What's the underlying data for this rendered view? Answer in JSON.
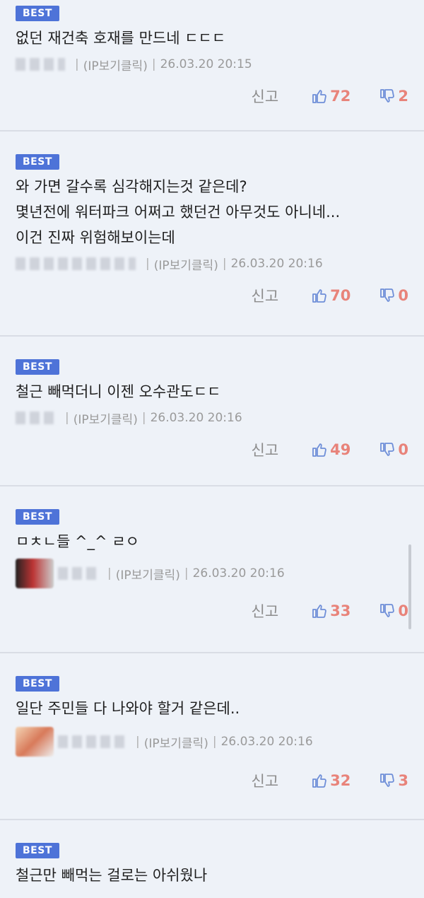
{
  "labels": {
    "best": "BEST",
    "report": "신고",
    "ip": "(IP보기클릭)"
  },
  "colors": {
    "best_badge": "#4e73d8",
    "vote_count": "#e8837a",
    "icon": "#6f8fd8",
    "background": "#eef2f8"
  },
  "comments": [
    {
      "text": "없던 재건축 호재를 만드네 ㄷㄷㄷ",
      "date": "26.03.20 20:15",
      "up": "72",
      "down": "2"
    },
    {
      "text": "와 가면 갈수록 심각해지는것 같은데?\n몇년전에 워터파크 어쩌고 했던건 아무것도 아니네...\n이건 진짜 위험해보이는데",
      "date": "26.03.20 20:16",
      "up": "70",
      "down": "0"
    },
    {
      "text": "철근 빼먹더니 이젠 오수관도ㄷㄷ",
      "date": "26.03.20 20:16",
      "up": "49",
      "down": "0"
    },
    {
      "text": "ㅁㅊㄴ들 ^_^ ㄹㅇ",
      "date": "26.03.20 20:16",
      "up": "33",
      "down": "0"
    },
    {
      "text": "일단 주민들 다 나와야 할거 같은데..",
      "date": "26.03.20 20:16",
      "up": "32",
      "down": "3"
    },
    {
      "text": "철근만 빼먹는 걸로는 아쉬웠나",
      "date": "",
      "up": "",
      "down": ""
    }
  ]
}
